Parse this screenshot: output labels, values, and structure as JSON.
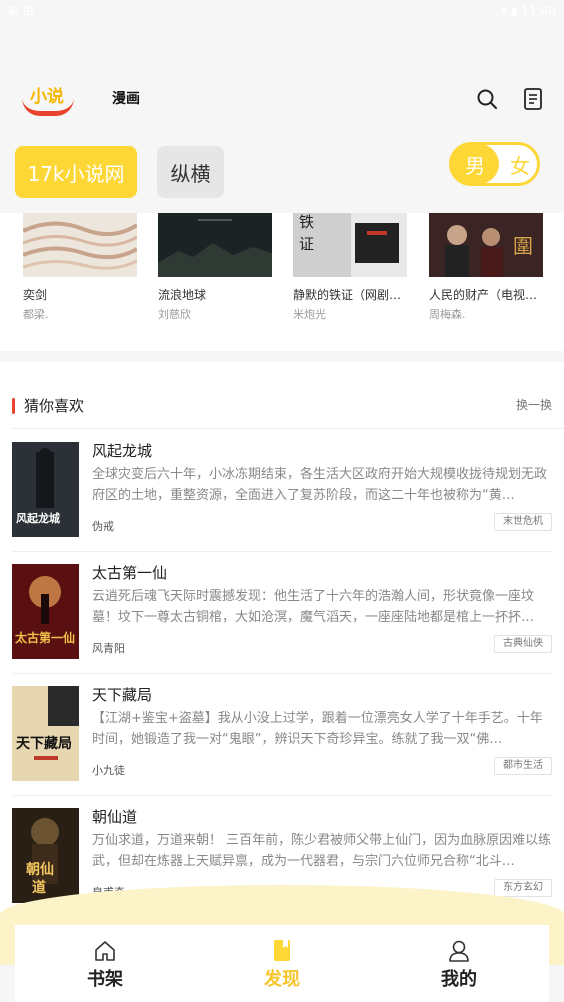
{
  "colors": {
    "accent": "#fcd735",
    "red": "#e8432c",
    "text": "#222222",
    "muted": "#888888"
  },
  "status": {
    "left": "⊕ ⊞",
    "right": "▾ ▮ 11:40"
  },
  "header": {
    "logo_text": "小说",
    "tab_comic": "漫画",
    "icons": [
      "search-icon",
      "bookshelf-doc-icon"
    ]
  },
  "sources": [
    {
      "label": "17k小说网",
      "active": true
    },
    {
      "label": "纵横",
      "active": false
    }
  ],
  "gender": {
    "male": "男",
    "female": "女",
    "selected": "男"
  },
  "strip_books": [
    {
      "title": "奕剑",
      "author": "都梁."
    },
    {
      "title": "流浪地球",
      "author": "刘慈欣"
    },
    {
      "title": "静默的铁证（网剧…",
      "author": "米炮光"
    },
    {
      "title": "人民的财产（电视…",
      "author": "周梅森."
    }
  ],
  "guess": {
    "title": "猜你喜欢",
    "refresh": "换一换",
    "items": [
      {
        "title": "风起龙城",
        "desc": "全球灾变后六十年，小冰冻期结束，各生活大区政府开始大规模收拢待规划无政府区的土地，重整资源，全面进入了复苏阶段，而这二十年也被称为“黄…",
        "author": "伪戒",
        "tag": "末世危机"
      },
      {
        "title": "太古第一仙",
        "desc": "云逍死后魂飞天际时震撼发现：他生活了十六年的浩瀚人间，形状竟像一座坟墓！坟下一尊太古铜棺，大如沧溟，魔气滔天，一座座陆地都是棺上一抔抔…",
        "author": "风青阳",
        "tag": "古典仙侠"
      },
      {
        "title": "天下藏局",
        "desc": "【江湖+鉴宝+盗墓】我从小没上过学，跟着一位漂亮女人学了十年手艺。十年时间，她锻造了我一对“鬼眼”，辨识天下奇珍异宝。练就了我一双“佛…",
        "author": "小九徒",
        "tag": "都市生活"
      },
      {
        "title": "朝仙道",
        "desc": "万仙求道，万道来朝！ 三百年前，陈少君被师父带上仙门，因为血脉原因难以练武，但却在炼器上天赋异禀，成为一代器君，与宗门六位师兄合称“北斗…",
        "author": "皇甫奇",
        "tag": "东方玄幻"
      }
    ]
  },
  "nav": [
    {
      "label": "书架",
      "icon": "home-icon",
      "active": false
    },
    {
      "label": "发现",
      "icon": "bookmark-icon",
      "active": true
    },
    {
      "label": "我的",
      "icon": "user-icon",
      "active": false
    }
  ]
}
